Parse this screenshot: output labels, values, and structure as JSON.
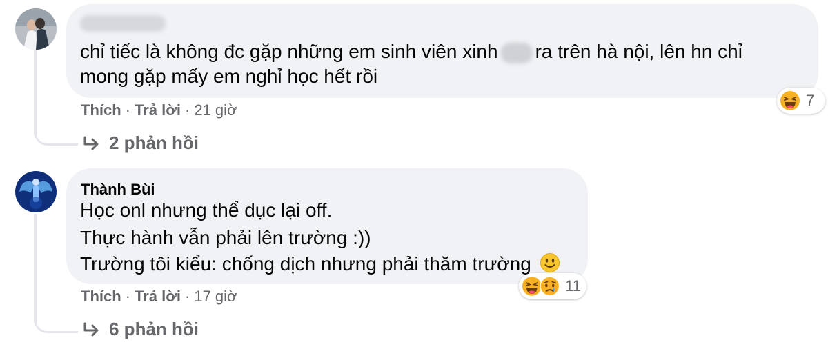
{
  "comments": [
    {
      "author": "",
      "text_line1_before": "chỉ tiếc là không đc gặp những em sinh viên xinh",
      "text_line1_after": "ra trên hà nội, lên hn chỉ",
      "text_line2": "mong gặp mấy em nghỉ học hết rồi",
      "like_label": "Thích",
      "reply_label": "Trả lời",
      "time": "21 giờ",
      "reaction_count": "7",
      "reaction_icons": [
        "haha-icon"
      ],
      "replies_label": "2 phản hồi"
    },
    {
      "author": "Thành Bùi",
      "text_lines": [
        "Học onl nhưng thể dục lại off.",
        "Thực hành vẫn phải lên trường :))",
        "Trường tôi kiểu: chống dịch nhưng phải thăm trường"
      ],
      "like_label": "Thích",
      "reply_label": "Trả lời",
      "time": "17 giờ",
      "reaction_count": "11",
      "reaction_icons": [
        "haha-icon",
        "sad-icon"
      ],
      "replies_label": "6 phản hồi"
    }
  ],
  "colors": {
    "bubble": "#f0f2f5",
    "secondary_text": "#65676b",
    "thread_line": "#e4e6eb",
    "reaction_yellow": "#f7b125"
  }
}
